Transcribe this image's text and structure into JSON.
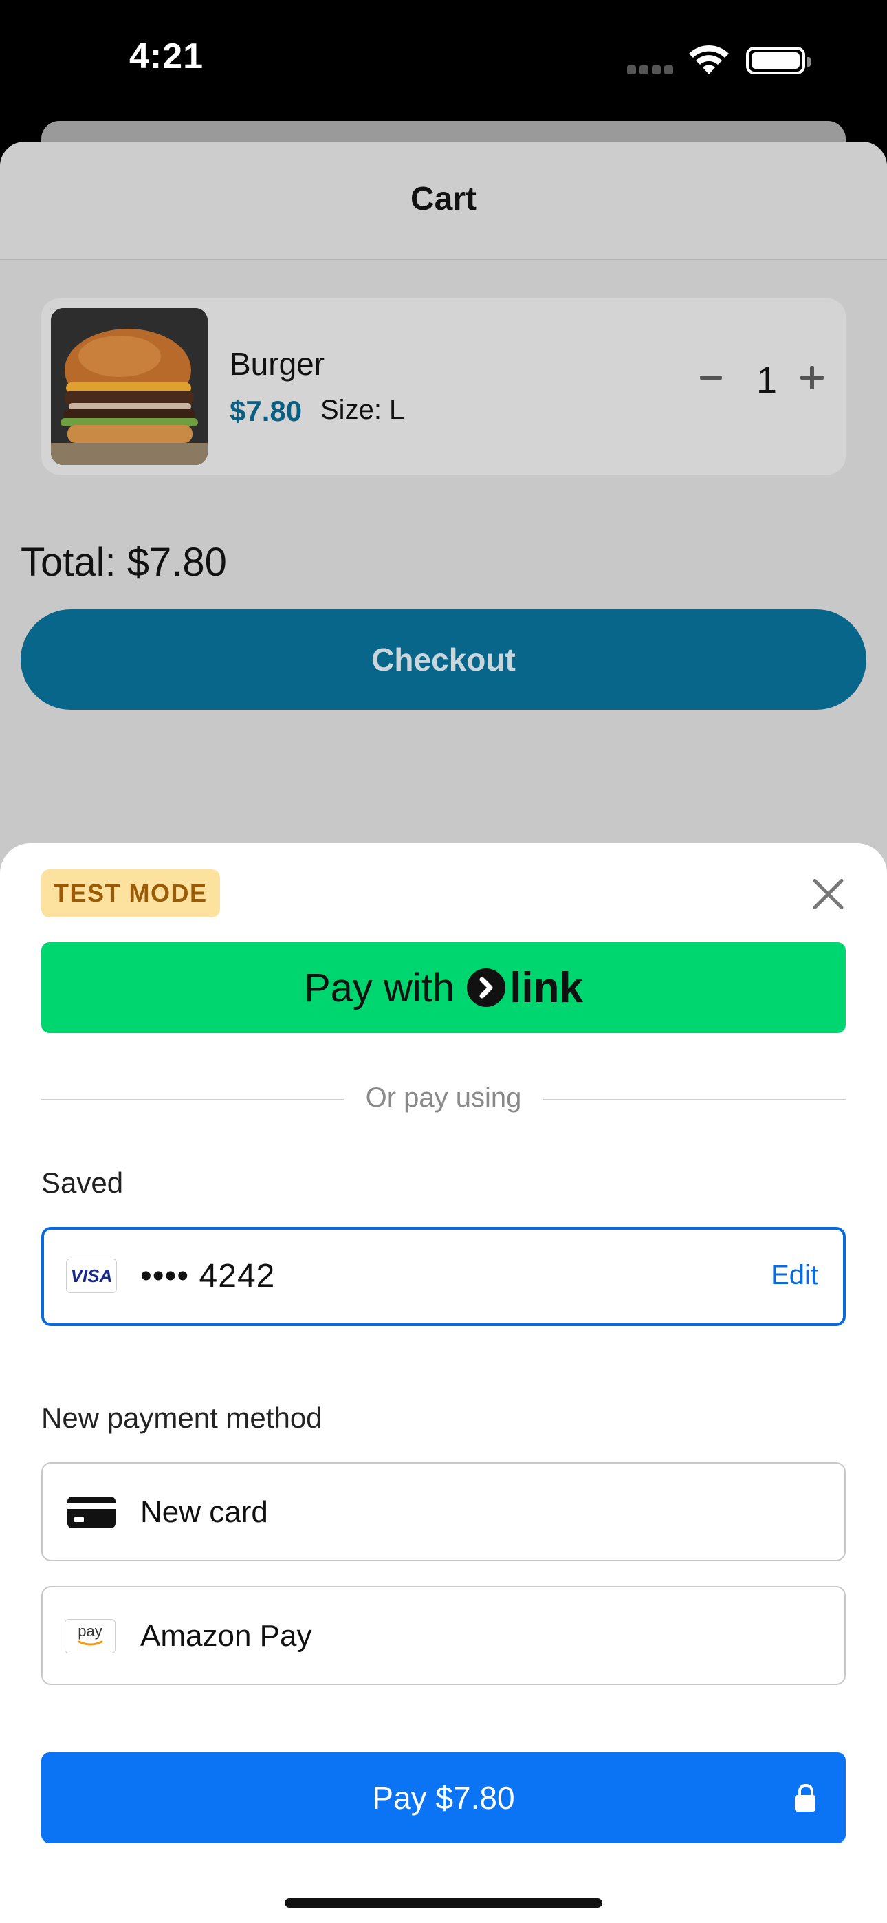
{
  "status_bar": {
    "time": "4:21"
  },
  "cart": {
    "title": "Cart",
    "item": {
      "name": "Burger",
      "price": "$7.80",
      "size": "Size: L",
      "quantity": "1"
    },
    "total": "Total: $7.80",
    "checkout_label": "Checkout"
  },
  "payment_sheet": {
    "test_mode_label": "TEST MODE",
    "link_button": {
      "pay_with": "Pay with",
      "brand": "link"
    },
    "divider_text": "Or pay using",
    "saved_label": "Saved",
    "saved_card": {
      "brand": "VISA",
      "masked": "•••• 4242",
      "edit_label": "Edit"
    },
    "new_method_label": "New payment method",
    "methods": [
      {
        "label": "New card",
        "icon": "credit-card-icon"
      },
      {
        "label": "Amazon Pay",
        "icon": "amazon-pay-icon",
        "icon_text": "pay"
      }
    ],
    "pay_button_label": "Pay $7.80"
  },
  "colors": {
    "accent": "#0a74f5",
    "link_green": "#00d66f",
    "checkout_teal": "#08668a",
    "test_badge": "#fde29f"
  }
}
